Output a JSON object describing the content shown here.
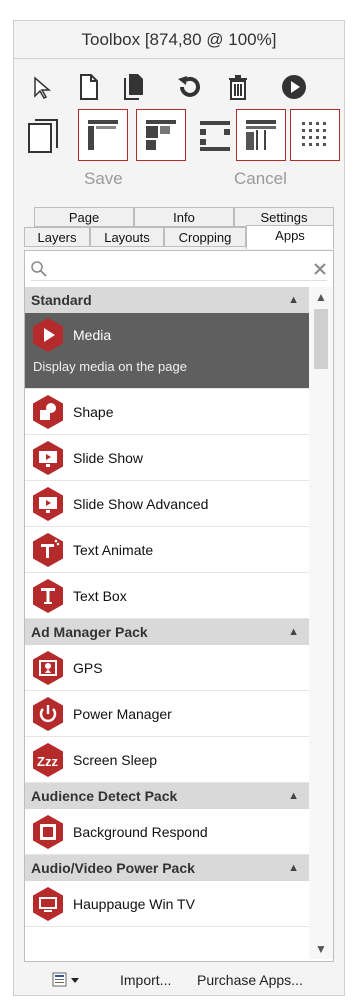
{
  "window": {
    "title": "Toolbox [874,80 @ 100%]"
  },
  "toolbar": {
    "row1_icons": [
      "pointer-icon",
      "new-page-icon",
      "copy-page-icon",
      "rotate-icon",
      "trash-icon",
      "play-icon"
    ],
    "row2_icons": [
      "page-frame-icon",
      "layout-a-icon",
      "layout-b-icon",
      "grid-dots-icon",
      "layout-c-icon",
      "layout-dots-icon"
    ],
    "save_label": "Save",
    "cancel_label": "Cancel"
  },
  "tabs": {
    "row1": [
      "Page",
      "Info",
      "Settings"
    ],
    "row2": [
      "Layers",
      "Layouts",
      "Cropping",
      "Apps"
    ],
    "active": "Apps"
  },
  "search": {
    "placeholder": "",
    "value": ""
  },
  "sections": [
    {
      "title": "Standard",
      "items": [
        {
          "label": "Media",
          "icon": "play-hex-icon",
          "selected": true,
          "description": "Display media on the page"
        },
        {
          "label": "Shape",
          "icon": "shape-hex-icon"
        },
        {
          "label": "Slide Show",
          "icon": "slideshow-hex-icon"
        },
        {
          "label": "Slide Show Advanced",
          "icon": "slideshow-advanced-hex-icon"
        },
        {
          "label": "Text Animate",
          "icon": "text-animate-hex-icon"
        },
        {
          "label": "Text Box",
          "icon": "text-box-hex-icon"
        }
      ]
    },
    {
      "title": "Ad Manager Pack",
      "items": [
        {
          "label": "GPS",
          "icon": "gps-hex-icon"
        },
        {
          "label": "Power Manager",
          "icon": "power-hex-icon"
        },
        {
          "label": "Screen Sleep",
          "icon": "sleep-hex-icon"
        }
      ]
    },
    {
      "title": "Audience Detect Pack",
      "items": [
        {
          "label": "Background Respond",
          "icon": "background-respond-hex-icon"
        }
      ]
    },
    {
      "title": "Audio/Video Power Pack",
      "items": [
        {
          "label": "Hauppauge Win TV",
          "icon": "tv-hex-icon"
        }
      ]
    }
  ],
  "footer": {
    "import_label": "Import...",
    "purchase_label": "Purchase Apps..."
  },
  "colors": {
    "accent": "#b52a2a",
    "selected_bg": "#5f5f5f",
    "section_bg": "#d9d9d9"
  }
}
